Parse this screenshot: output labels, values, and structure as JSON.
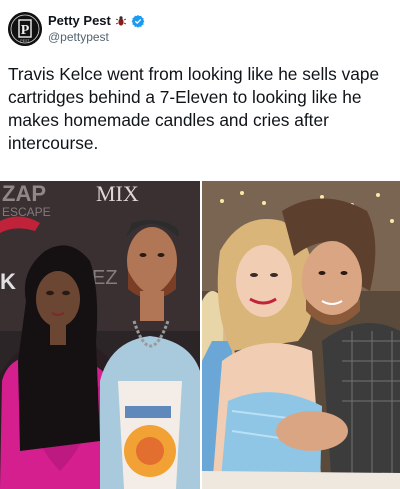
{
  "post": {
    "author": {
      "display_name": "Petty Pest",
      "handle": "@pettypest",
      "avatar_icon": "petty-pest-logo",
      "badges": [
        "bug-emoji-icon",
        "verified-check-icon"
      ],
      "verified_color": "#1d9bf0",
      "avatar_logo_text": "PETTY PEST"
    },
    "text": "Travis Kelce went from looking like he sells vape cartridges behind a 7-Eleven to looking like he makes homemade candles and cries after intercourse.",
    "media": {
      "left_photo": {
        "backdrop_text": "MIX"
      },
      "right_photo": {}
    }
  }
}
